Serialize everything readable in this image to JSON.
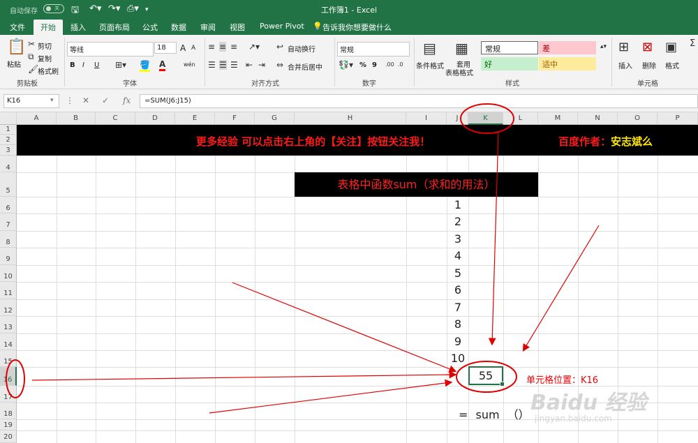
{
  "titlebar": {
    "autosave": "自动保存",
    "toggle": "关",
    "doc_title": "工作簿1  -  Excel"
  },
  "tabs": [
    "文件",
    "开始",
    "插入",
    "页面布局",
    "公式",
    "数据",
    "审阅",
    "视图",
    "Power Pivot"
  ],
  "tell_me": "告诉我你想要做什么",
  "ribbon": {
    "clipboard": {
      "paste": "粘贴",
      "cut": "剪切",
      "copy": "复制",
      "format_painter": "格式刷",
      "label": "剪贴板"
    },
    "font": {
      "name": "等线",
      "size": "18",
      "grow": "A",
      "shrink": "A",
      "bold": "B",
      "italic": "I",
      "underline": "U",
      "phonetic": "wén",
      "label": "字体"
    },
    "alignment": {
      "wrap": "自动换行",
      "merge": "合并后居中",
      "label": "对齐方式"
    },
    "number": {
      "format": "常规",
      "percent": "%",
      "comma": "9",
      "label": "数字"
    },
    "styles": {
      "conditional": "条件格式",
      "table1": "套用",
      "table2": "表格格式",
      "normal": "常规",
      "bad": "差",
      "good": "好",
      "neutral": "适中",
      "label": "样式"
    },
    "cells": {
      "insert": "插入",
      "delete": "删除",
      "format": "格式",
      "label": "单元格"
    }
  },
  "colors": {
    "excel_green": "#217346",
    "bad_bg": "#ffc7ce",
    "good_bg": "#c6efce",
    "neutral_bg": "#ffeb9c",
    "annotation_red": "#e00000"
  },
  "formula_bar": {
    "cell_ref": "K16",
    "formula": "=SUM(J6:J15)"
  },
  "columns": [
    "A",
    "B",
    "C",
    "D",
    "E",
    "F",
    "G",
    "H",
    "I",
    "J",
    "K",
    "L",
    "M",
    "N",
    "O",
    "P"
  ],
  "rows": [
    "1",
    "2",
    "3",
    "4",
    "5",
    "6",
    "7",
    "8",
    "9",
    "10",
    "11",
    "12",
    "13",
    "14",
    "15",
    "16",
    "17",
    "18",
    "19",
    "20"
  ],
  "sheet": {
    "banner_left": "更多经验 可以点击右上角的【关注】按钮关注我！",
    "banner_right_prefix": "百度作者：",
    "banner_right_name": "安志斌么",
    "heading": "表格中函数sum（求和的用法）",
    "numbers": [
      "1",
      "2",
      "3",
      "4",
      "5",
      "6",
      "7",
      "8",
      "9",
      "10"
    ],
    "result": "55",
    "cell_position": "单元格位置：K16",
    "sum_note": "= sum  （）"
  },
  "watermark": {
    "logo": "Baidu 经验",
    "url": "jingyan.baidu.com"
  }
}
